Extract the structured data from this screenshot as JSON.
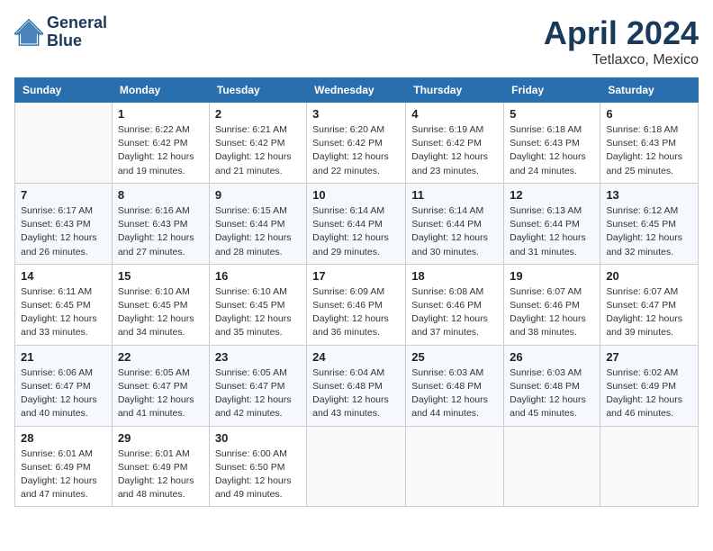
{
  "header": {
    "logo_line1": "General",
    "logo_line2": "Blue",
    "month": "April 2024",
    "location": "Tetlaxco, Mexico"
  },
  "weekdays": [
    "Sunday",
    "Monday",
    "Tuesday",
    "Wednesday",
    "Thursday",
    "Friday",
    "Saturday"
  ],
  "weeks": [
    [
      {
        "num": "",
        "info": ""
      },
      {
        "num": "1",
        "info": "Sunrise: 6:22 AM\nSunset: 6:42 PM\nDaylight: 12 hours\nand 19 minutes."
      },
      {
        "num": "2",
        "info": "Sunrise: 6:21 AM\nSunset: 6:42 PM\nDaylight: 12 hours\nand 21 minutes."
      },
      {
        "num": "3",
        "info": "Sunrise: 6:20 AM\nSunset: 6:42 PM\nDaylight: 12 hours\nand 22 minutes."
      },
      {
        "num": "4",
        "info": "Sunrise: 6:19 AM\nSunset: 6:42 PM\nDaylight: 12 hours\nand 23 minutes."
      },
      {
        "num": "5",
        "info": "Sunrise: 6:18 AM\nSunset: 6:43 PM\nDaylight: 12 hours\nand 24 minutes."
      },
      {
        "num": "6",
        "info": "Sunrise: 6:18 AM\nSunset: 6:43 PM\nDaylight: 12 hours\nand 25 minutes."
      }
    ],
    [
      {
        "num": "7",
        "info": "Sunrise: 6:17 AM\nSunset: 6:43 PM\nDaylight: 12 hours\nand 26 minutes."
      },
      {
        "num": "8",
        "info": "Sunrise: 6:16 AM\nSunset: 6:43 PM\nDaylight: 12 hours\nand 27 minutes."
      },
      {
        "num": "9",
        "info": "Sunrise: 6:15 AM\nSunset: 6:44 PM\nDaylight: 12 hours\nand 28 minutes."
      },
      {
        "num": "10",
        "info": "Sunrise: 6:14 AM\nSunset: 6:44 PM\nDaylight: 12 hours\nand 29 minutes."
      },
      {
        "num": "11",
        "info": "Sunrise: 6:14 AM\nSunset: 6:44 PM\nDaylight: 12 hours\nand 30 minutes."
      },
      {
        "num": "12",
        "info": "Sunrise: 6:13 AM\nSunset: 6:44 PM\nDaylight: 12 hours\nand 31 minutes."
      },
      {
        "num": "13",
        "info": "Sunrise: 6:12 AM\nSunset: 6:45 PM\nDaylight: 12 hours\nand 32 minutes."
      }
    ],
    [
      {
        "num": "14",
        "info": "Sunrise: 6:11 AM\nSunset: 6:45 PM\nDaylight: 12 hours\nand 33 minutes."
      },
      {
        "num": "15",
        "info": "Sunrise: 6:10 AM\nSunset: 6:45 PM\nDaylight: 12 hours\nand 34 minutes."
      },
      {
        "num": "16",
        "info": "Sunrise: 6:10 AM\nSunset: 6:45 PM\nDaylight: 12 hours\nand 35 minutes."
      },
      {
        "num": "17",
        "info": "Sunrise: 6:09 AM\nSunset: 6:46 PM\nDaylight: 12 hours\nand 36 minutes."
      },
      {
        "num": "18",
        "info": "Sunrise: 6:08 AM\nSunset: 6:46 PM\nDaylight: 12 hours\nand 37 minutes."
      },
      {
        "num": "19",
        "info": "Sunrise: 6:07 AM\nSunset: 6:46 PM\nDaylight: 12 hours\nand 38 minutes."
      },
      {
        "num": "20",
        "info": "Sunrise: 6:07 AM\nSunset: 6:47 PM\nDaylight: 12 hours\nand 39 minutes."
      }
    ],
    [
      {
        "num": "21",
        "info": "Sunrise: 6:06 AM\nSunset: 6:47 PM\nDaylight: 12 hours\nand 40 minutes."
      },
      {
        "num": "22",
        "info": "Sunrise: 6:05 AM\nSunset: 6:47 PM\nDaylight: 12 hours\nand 41 minutes."
      },
      {
        "num": "23",
        "info": "Sunrise: 6:05 AM\nSunset: 6:47 PM\nDaylight: 12 hours\nand 42 minutes."
      },
      {
        "num": "24",
        "info": "Sunrise: 6:04 AM\nSunset: 6:48 PM\nDaylight: 12 hours\nand 43 minutes."
      },
      {
        "num": "25",
        "info": "Sunrise: 6:03 AM\nSunset: 6:48 PM\nDaylight: 12 hours\nand 44 minutes."
      },
      {
        "num": "26",
        "info": "Sunrise: 6:03 AM\nSunset: 6:48 PM\nDaylight: 12 hours\nand 45 minutes."
      },
      {
        "num": "27",
        "info": "Sunrise: 6:02 AM\nSunset: 6:49 PM\nDaylight: 12 hours\nand 46 minutes."
      }
    ],
    [
      {
        "num": "28",
        "info": "Sunrise: 6:01 AM\nSunset: 6:49 PM\nDaylight: 12 hours\nand 47 minutes."
      },
      {
        "num": "29",
        "info": "Sunrise: 6:01 AM\nSunset: 6:49 PM\nDaylight: 12 hours\nand 48 minutes."
      },
      {
        "num": "30",
        "info": "Sunrise: 6:00 AM\nSunset: 6:50 PM\nDaylight: 12 hours\nand 49 minutes."
      },
      {
        "num": "",
        "info": ""
      },
      {
        "num": "",
        "info": ""
      },
      {
        "num": "",
        "info": ""
      },
      {
        "num": "",
        "info": ""
      }
    ]
  ]
}
